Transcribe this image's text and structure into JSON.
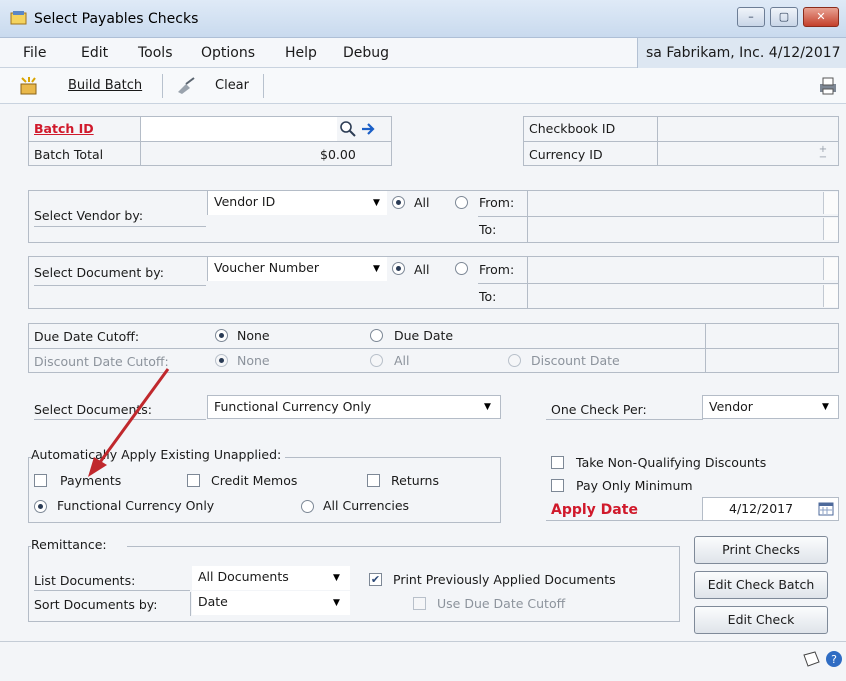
{
  "window": {
    "title": "Select Payables Checks",
    "min": "–",
    "max": "▢",
    "close": "✕"
  },
  "menu": {
    "items": [
      "File",
      "Edit",
      "Tools",
      "Options",
      "Help",
      "Debug"
    ],
    "company": "sa  Fabrikam, Inc. 4/12/2017"
  },
  "toolbar": {
    "build_batch": "Build Batch",
    "clear": "Clear"
  },
  "batch": {
    "id_label": "Batch ID",
    "id_value": "",
    "total_label": "Batch Total",
    "total_value": "$0.00",
    "checkbook_label": "Checkbook ID",
    "checkbook_value": "",
    "currency_label": "Currency ID",
    "currency_value": ""
  },
  "vendor": {
    "label": "Select Vendor by:",
    "value": "Vendor ID",
    "all": "All",
    "from": "From:",
    "to": "To:"
  },
  "document": {
    "label": "Select Document by:",
    "value": "Voucher Number",
    "all": "All",
    "from": "From:",
    "to": "To:"
  },
  "cutoff": {
    "due_label": "Due Date Cutoff:",
    "none": "None",
    "due_date": "Due Date",
    "discount_label": "Discount Date Cutoff:",
    "all": "All",
    "discount_date": "Discount Date"
  },
  "select_docs": {
    "label": "Select Documents:",
    "value": "Functional Currency Only",
    "one_check_label": "One Check Per:",
    "one_check_value": "Vendor"
  },
  "auto_apply": {
    "title": "Automatically Apply Existing Unapplied:",
    "payments": "Payments",
    "credit_memos": "Credit Memos",
    "returns": "Returns",
    "functional": "Functional Currency Only",
    "all_currencies": "All Currencies"
  },
  "options": {
    "take_non_qualifying": "Take Non-Qualifying Discounts",
    "pay_only_minimum": "Pay Only Minimum",
    "apply_date_label": "Apply Date",
    "apply_date_value": "4/12/2017"
  },
  "remittance": {
    "title": "Remittance:",
    "list_label": "List Documents:",
    "list_value": "All Documents",
    "sort_label": "Sort Documents by:",
    "sort_value": "Date",
    "print_prev": "Print Previously Applied Documents",
    "use_due": "Use Due Date Cutoff"
  },
  "buttons": {
    "print_checks": "Print Checks",
    "edit_batch": "Edit Check Batch",
    "edit_check": "Edit Check"
  },
  "colors": {
    "required_label": "#d0192b",
    "arrow": "#c0282d",
    "title_bar": "#c9daee"
  }
}
